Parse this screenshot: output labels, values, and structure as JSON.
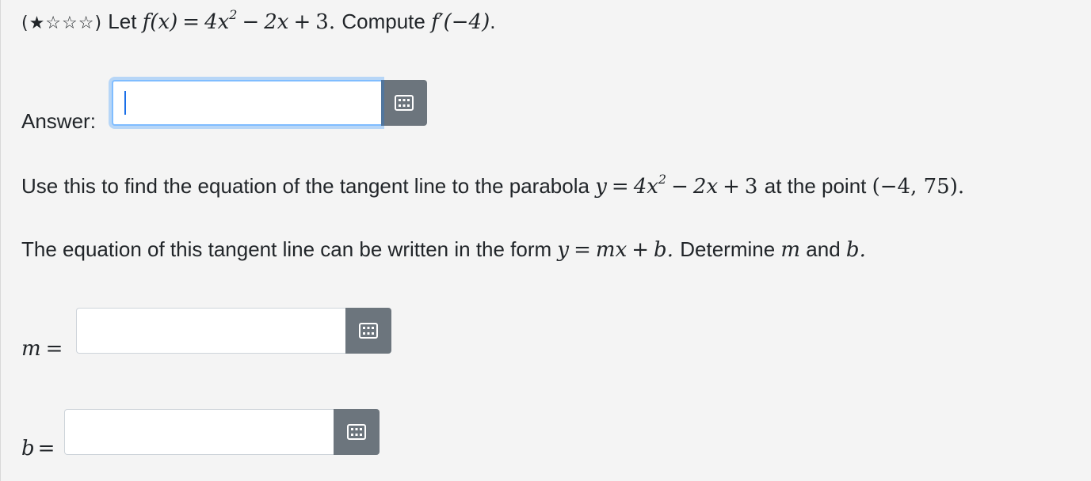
{
  "question": {
    "difficulty_stars": "(★☆☆☆)",
    "let_word": "Let",
    "f_of_x": "f(x)",
    "eq": "=",
    "rhs_a": "4x",
    "rhs_exp": "2",
    "minus": "−",
    "rhs_b": "2x",
    "plus": "+",
    "rhs_c": "3.",
    "compute_word": "Compute",
    "fprime": "f′(−4)",
    "period": "."
  },
  "answer": {
    "label": "Answer:",
    "value": ""
  },
  "tangent_prompt": {
    "text_before": "Use this to find the equation of the tangent line to the parabola",
    "y": "y",
    "eq": "=",
    "a": "4x",
    "exp": "2",
    "minus": "−",
    "b": "2x",
    "plus": "+",
    "c": "3",
    "text_mid": "at the point",
    "point": "(−4, 75).",
    "period": ""
  },
  "form_prompt": {
    "text_before": "The equation of this tangent line can be written in the form",
    "y": "y",
    "eq": "=",
    "mx": "mx",
    "plus": "+",
    "b": "b.",
    "text_after": "Determine",
    "m": "m",
    "and": "and",
    "b_end": "b."
  },
  "m_field": {
    "label_var": "m",
    "label_eq": "=",
    "value": ""
  },
  "b_field": {
    "label_var": "b",
    "label_eq": "=",
    "value": ""
  },
  "icons": {
    "keyboard": "keyboard-icon"
  },
  "colors": {
    "background": "#f4f4f4",
    "button": "#6c757d",
    "focus": "#80bdff"
  }
}
